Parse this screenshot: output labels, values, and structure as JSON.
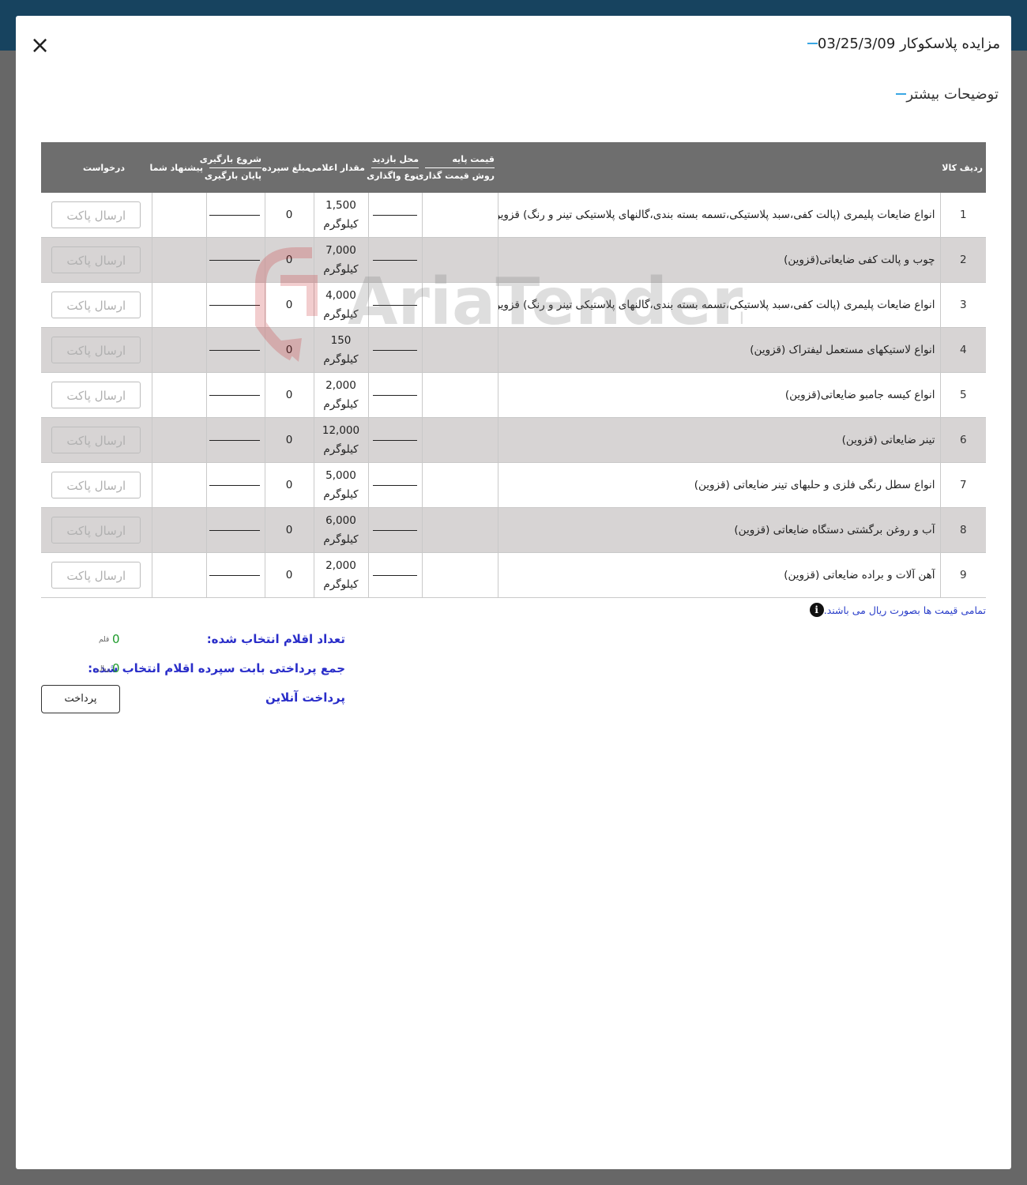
{
  "modal": {
    "title": "مزایده پلاسکوکار 03/25/3/09",
    "more_details": "توضیحات بیشتر",
    "close_symbol": "×"
  },
  "table": {
    "headers": {
      "row_item": "ردیف کالا",
      "base_price": "قیمت پایه",
      "pricing_method": "روش قیمت گذاری",
      "visit_location": "محل بازدید",
      "assignment_type": "نوع واگذاری",
      "announced_amount": "مقدار اعلامی",
      "deposit_amount": "مبلغ سپرده",
      "loading_start": "شروع بارگیری",
      "loading_end": "پایان بارگیری",
      "your_offer": "پیشنهاد شما",
      "request": "درخواست"
    },
    "rows": [
      {
        "num": "1",
        "name": "انواع ضایعات پلیمری (پالت کفی،سبد پلاستیکی،تسمه بسته بندی،گالنهای پلاستیکی تینر و رنگ) قزوین",
        "qty": "1,500",
        "unit": "کیلوگرم",
        "deposit": "0",
        "action": "ارسال پاکت"
      },
      {
        "num": "2",
        "name": "چوب و پالت کفی ضایعاتی(قزوین)",
        "qty": "7,000",
        "unit": "کیلوگرم",
        "deposit": "0",
        "action": "ارسال پاکت"
      },
      {
        "num": "3",
        "name": "انواع ضایعات پلیمری (پالت کفی،سبد پلاستیکی،تسمه بسته بندی،گالنهای پلاستیکی تینر و رنگ) قزوین",
        "qty": "4,000",
        "unit": "کیلوگرم",
        "deposit": "0",
        "action": "ارسال پاکت"
      },
      {
        "num": "4",
        "name": "انواع لاستیکهای مستعمل لیفتراک (قزوین)",
        "qty": "150",
        "unit": "کیلوگرم",
        "deposit": "0",
        "action": "ارسال پاکت"
      },
      {
        "num": "5",
        "name": "انواع کیسه جامبو ضایعاتی(قزوین)",
        "qty": "2,000",
        "unit": "کیلوگرم",
        "deposit": "0",
        "action": "ارسال پاکت"
      },
      {
        "num": "6",
        "name": "تینر ضایعاتی (قزوین)",
        "qty": "12,000",
        "unit": "کیلوگرم",
        "deposit": "0",
        "action": "ارسال پاکت"
      },
      {
        "num": "7",
        "name": "انواع سطل رنگی فلزی و حلبهای تینر ضایعاتی (قزوین)",
        "qty": "5,000",
        "unit": "کیلوگرم",
        "deposit": "0",
        "action": "ارسال پاکت"
      },
      {
        "num": "8",
        "name": "آب و روغن برگشتی دستگاه ضایعاتی (قزوین)",
        "qty": "6,000",
        "unit": "کیلوگرم",
        "deposit": "0",
        "action": "ارسال پاکت"
      },
      {
        "num": "9",
        "name": "آهن آلات و براده ضایعاتی (قزوین)",
        "qty": "2,000",
        "unit": "کیلوگرم",
        "deposit": "0",
        "action": "ارسال پاکت"
      }
    ]
  },
  "note": {
    "icon": "info-icon",
    "text": "تمامی قیمت ها بصورت ریال می باشند."
  },
  "summary": {
    "selected_count_label": "تعداد اقلام انتخاب شده:",
    "selected_count_value": "0",
    "selected_count_unit": "قلم",
    "payment_total_label": "جمع پرداختی بابت سپرده اقلام انتخاب شده:",
    "payment_total_value": "0",
    "payment_total_unit": "ریال",
    "online_payment_label": "پرداخت آنلاین",
    "pay_button": "پرداخت"
  },
  "watermark": {
    "text": "AriaTender.neT"
  },
  "colors": {
    "header_band": "#17435f",
    "overlay": "#676767",
    "accent": "#3aa7e4",
    "table_header": "#6e6e6e",
    "alt_row": "#d7d4d4",
    "blue_label": "#2a2ec9",
    "green_value": "#1c9a2a"
  }
}
